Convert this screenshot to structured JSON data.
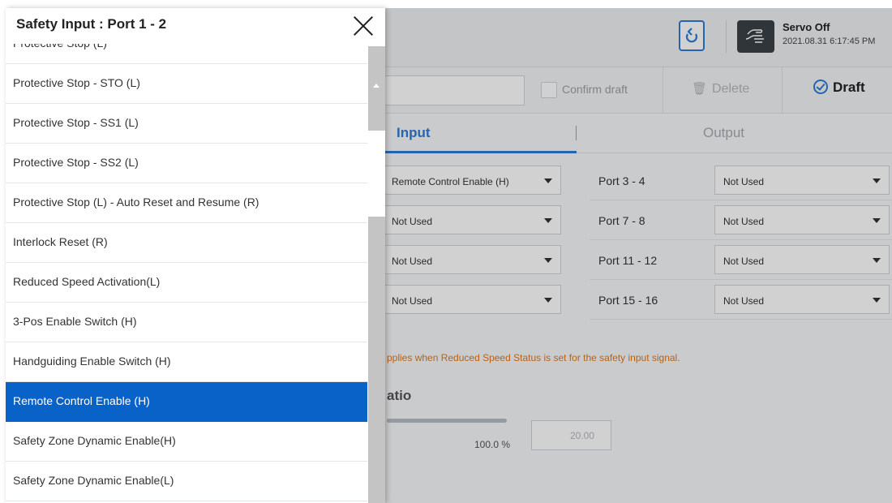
{
  "drawer": {
    "title": "Safety Input : Port 1 - 2",
    "partial_item": "Protective Stop (L)",
    "options": [
      "Protective Stop - STO (L)",
      "Protective Stop - SS1 (L)",
      "Protective Stop - SS2 (L)",
      "Protective Stop (L) - Auto Reset and Resume (R)",
      "Interlock Reset (R)",
      "Reduced Speed Activation(L)",
      "3-Pos Enable Switch (H)",
      "Handguiding Enable Switch (H)",
      "Remote Control Enable (H)",
      "Safety Zone Dynamic Enable(H)",
      "Safety Zone Dynamic Enable(L)"
    ],
    "selected": "Remote Control Enable (H)"
  },
  "header": {
    "servo_status": "Servo Off",
    "datetime": "2021.08.31 6:17:45 PM",
    "home_icon": "refresh-icon",
    "servo_icon": "hand-icon"
  },
  "toolbar": {
    "confirm_label": "Confirm draft",
    "delete_label": "Delete",
    "draft_label": "Draft"
  },
  "tabs": {
    "input": "Input",
    "output": "Output"
  },
  "ports": {
    "rows": [
      {
        "left_value": "Remote Control Enable (H)",
        "right_label": "Port 3 - 4",
        "right_value": "Not Used"
      },
      {
        "left_value": "Not Used",
        "right_label": "Port 7 - 8",
        "right_value": "Not Used"
      },
      {
        "left_value": "Not Used",
        "right_label": "Port 11 - 12",
        "right_value": "Not Used"
      },
      {
        "left_value": "Not Used",
        "right_label": "Port 15 - 16",
        "right_value": "Not Used"
      }
    ]
  },
  "notice": "pplies when Reduced Speed Status is set for the safety input signal.",
  "ratio": {
    "title": "atio",
    "percent": "100.0 %",
    "value": "20.00"
  },
  "colors": {
    "accent": "#2d7bd8",
    "selected_bg": "#0962c7",
    "warning": "#e0781a"
  }
}
